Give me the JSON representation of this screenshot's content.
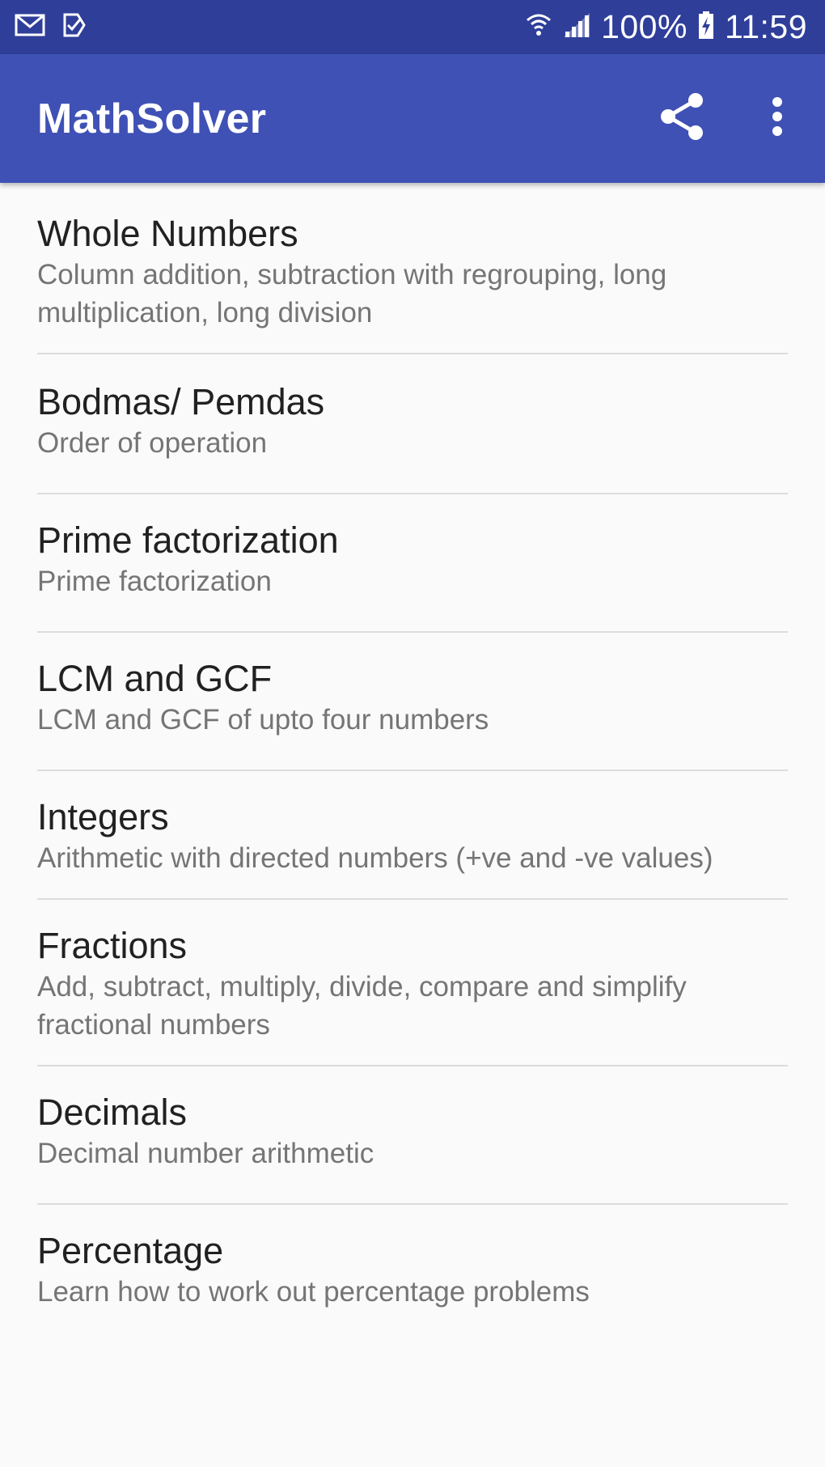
{
  "status_bar": {
    "icons_left": [
      "mail-icon",
      "task-check-icon"
    ],
    "icons_right": [
      "wifi-icon",
      "signal-icon",
      "battery-charging-icon"
    ],
    "battery": "100%",
    "time": "11:59"
  },
  "app_bar": {
    "title": "MathSolver",
    "actions": [
      "share-icon",
      "more-vert-icon"
    ]
  },
  "topics": [
    {
      "title": "Whole Numbers",
      "description": "Column addition, subtraction with regrouping, long multiplication, long division"
    },
    {
      "title": "Bodmas/ Pemdas",
      "description": "Order of operation"
    },
    {
      "title": "Prime factorization",
      "description": "Prime factorization"
    },
    {
      "title": "LCM and GCF",
      "description": "LCM and GCF of upto four numbers"
    },
    {
      "title": "Integers",
      "description": "Arithmetic with directed numbers (+ve and -ve values)"
    },
    {
      "title": "Fractions",
      "description": "Add, subtract, multiply, divide, compare and simplify fractional numbers"
    },
    {
      "title": "Decimals",
      "description": "Decimal number arithmetic"
    },
    {
      "title": "Percentage",
      "description": "Learn how to work out percentage problems"
    }
  ],
  "colors": {
    "status_bar": "#2f3e99",
    "app_bar": "#3f51b5",
    "background": "#fafafa",
    "title_text": "#212121",
    "secondary_text": "#757575",
    "divider": "#dcdcdc"
  }
}
